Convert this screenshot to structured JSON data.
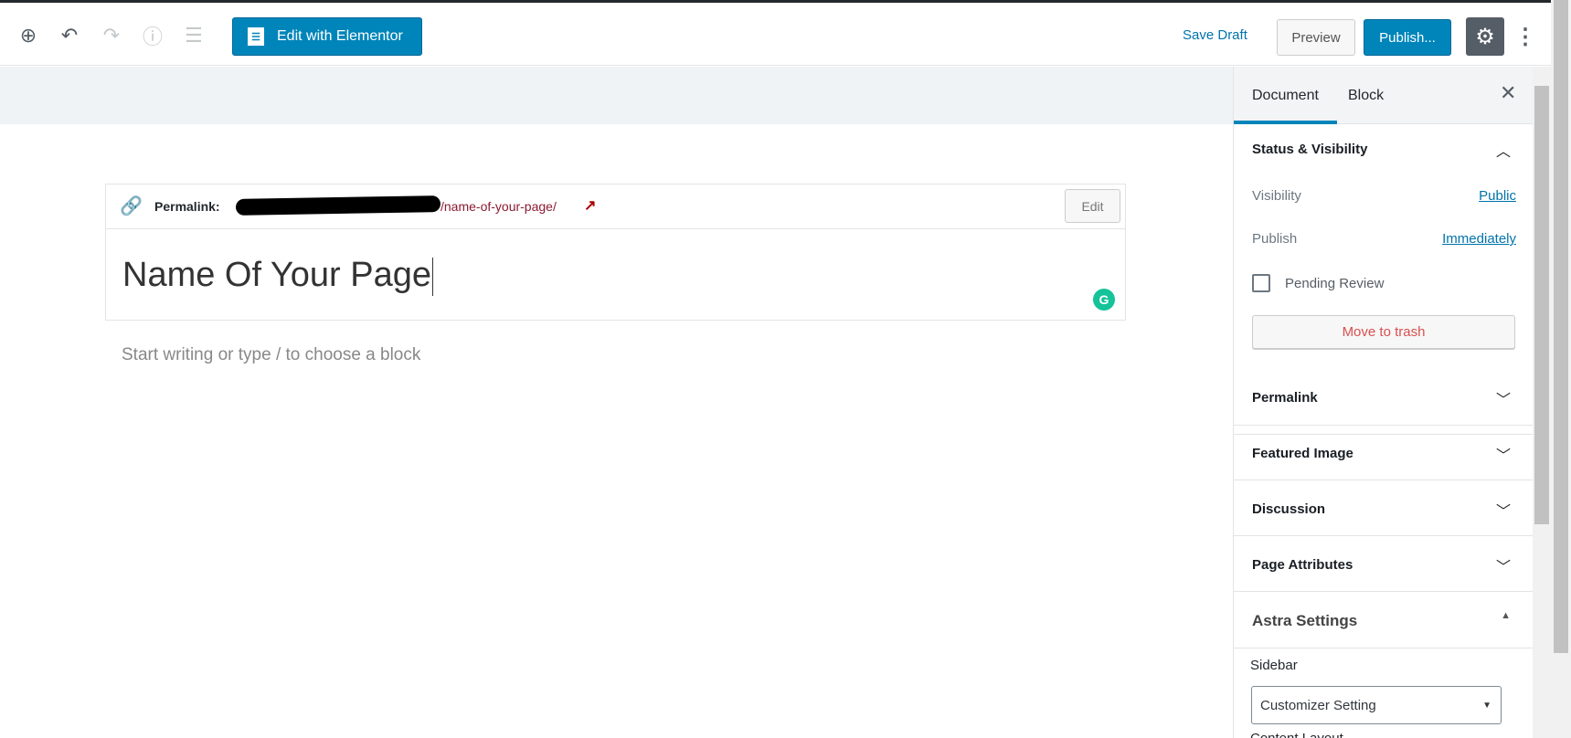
{
  "toolbar": {
    "icons": [
      "add-block-icon",
      "undo-icon",
      "redo-icon",
      "info-icon",
      "outline-icon"
    ],
    "elementor_label": "Edit with Elementor",
    "save_draft": "Save Draft",
    "preview": "Preview",
    "publish": "Publish...",
    "accent": "#0085ba"
  },
  "editor": {
    "permalink_label": "Permalink:",
    "permalink_slug": "/name-of-your-page/",
    "edit_label": "Edit",
    "title": "Name Of Your Page",
    "placeholder": "Start writing or type / to choose a block"
  },
  "sidebar": {
    "tabs": [
      {
        "label": "Document",
        "active": true
      },
      {
        "label": "Block",
        "active": false
      }
    ],
    "status": {
      "title": "Status & Visibility",
      "visibility_label": "Visibility",
      "visibility_value": "Public",
      "publish_label": "Publish",
      "publish_value": "Immediately",
      "pending_label": "Pending Review",
      "pending_checked": false,
      "trash_label": "Move to trash"
    },
    "panels": [
      "Permalink",
      "Featured Image",
      "Discussion",
      "Page Attributes"
    ],
    "astra": {
      "title": "Astra Settings",
      "sidebar_label": "Sidebar",
      "sidebar_value": "Customizer Setting",
      "content_layout_label": "Content Layout"
    }
  }
}
